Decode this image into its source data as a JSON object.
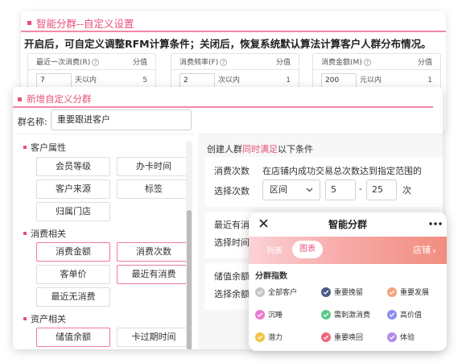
{
  "panel1": {
    "title": "智能分群--自定义设置",
    "description": "开启后，可自定义调整RFM计算条件；关闭后，恢复系统默认算法计算客户人群分布情况。",
    "cards": [
      {
        "label": "最近一次消费(R)",
        "col": "分值",
        "value": "7",
        "unit": "天以内",
        "score": "5"
      },
      {
        "label": "消费频率(F)",
        "col": "分值",
        "value": "2",
        "unit": "次以内",
        "score": "1"
      },
      {
        "label": "消费金额(M)",
        "col": "分值",
        "value": "200",
        "unit": "元以内",
        "score": "1"
      }
    ]
  },
  "panel2": {
    "title": "新增自定义分群",
    "group_name_label": "群名称:",
    "group_name_value": "重要跟进客户",
    "sections": [
      {
        "title": "客户属性",
        "buttons": [
          "会员等级",
          "办卡时间",
          "客户来源",
          "标签",
          "归属门店"
        ]
      },
      {
        "title": "消费相关",
        "buttons": [
          "消费金额",
          "消费次数",
          "客单价",
          "最近有消费",
          "最近无消费"
        ]
      },
      {
        "title": "资产相关",
        "buttons": [
          "储值余额",
          "卡过期时间"
        ]
      }
    ],
    "active_buttons": [
      "消费金额",
      "消费次数",
      "最近有消费",
      "储值余额"
    ],
    "rule_header_prefix": "创建人群",
    "rule_header_highlight": "同时满足",
    "rule_header_suffix": "以下条件",
    "rule1": {
      "title": "消费次数",
      "desc": "在店铺内成功交易总次数达到指定范围的",
      "select_label": "选择次数",
      "select_value": "区间",
      "from": "5",
      "dash": "-",
      "to": "25",
      "unit": "次"
    },
    "rule2": {
      "title": "最近有消",
      "select_label": "选择时间"
    },
    "rule3": {
      "title": "储值余额",
      "select_label": "选择余额"
    }
  },
  "phone": {
    "title": "智能分群",
    "tabs": [
      "列表",
      "图表"
    ],
    "active_tab": "图表",
    "store": "店铺",
    "section": "分群指数",
    "items": [
      {
        "label": "全部客户",
        "color": "#c7c7c7"
      },
      {
        "label": "重要挽留",
        "color": "#4a5a8a"
      },
      {
        "label": "重要发展",
        "color": "#f4a27d"
      },
      {
        "label": "沉睡",
        "color": "#e87ad1"
      },
      {
        "label": "需刺激消费",
        "color": "#5cc98a"
      },
      {
        "label": "高价值",
        "color": "#8a8cf0"
      },
      {
        "label": "潜力",
        "color": "#f3c244"
      },
      {
        "label": "重要唤回",
        "color": "#f0667a"
      },
      {
        "label": "体验",
        "color": "#b189e8"
      }
    ]
  },
  "colors": {
    "accent": "#e8507a"
  }
}
